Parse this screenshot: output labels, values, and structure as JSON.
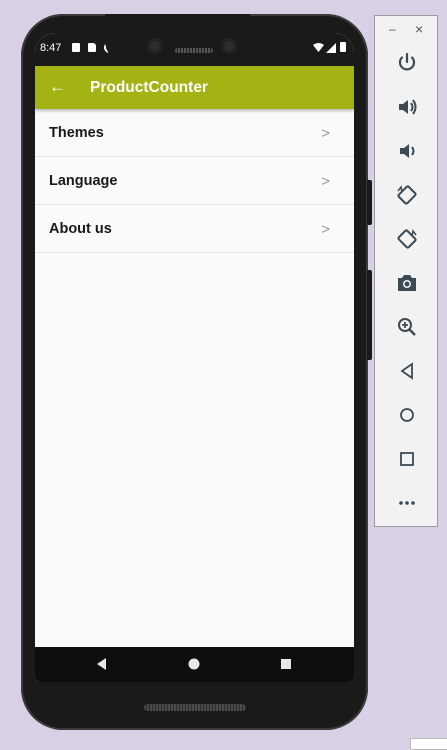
{
  "status_bar": {
    "time": "8:47"
  },
  "app_bar": {
    "back_glyph": "←",
    "title": "ProductCounter"
  },
  "settings": {
    "items": [
      {
        "label": "Themes",
        "chevron": ">"
      },
      {
        "label": "Language",
        "chevron": ">"
      },
      {
        "label": "About us",
        "chevron": ">"
      }
    ]
  },
  "emulator_toolbar": {
    "minimize_glyph": "–",
    "close_glyph": "×",
    "buttons": [
      "power-icon",
      "volume-up-icon",
      "volume-down-icon",
      "rotate-left-icon",
      "rotate-right-icon",
      "camera-icon",
      "zoom-icon",
      "back-icon",
      "home-icon",
      "overview-icon",
      "more-icon"
    ]
  },
  "colors": {
    "accent": "#a4b214",
    "background": "#d9d0e6"
  }
}
